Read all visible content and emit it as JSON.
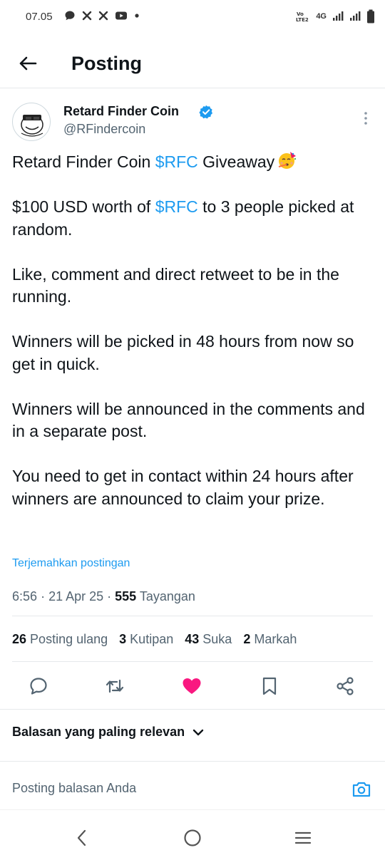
{
  "status_bar": {
    "time": "07.05",
    "network_label": "4G",
    "volte_label": "VoLTE2",
    "icons": [
      "chat-bubble-icon",
      "x-logo-icon",
      "x-logo-icon",
      "youtube-icon",
      "dot-icon",
      "volte-icon",
      "signal-icon",
      "signal-icon",
      "battery-icon"
    ]
  },
  "header": {
    "title": "Posting",
    "back_icon": "arrow-left-icon"
  },
  "post": {
    "author": {
      "name": "Retard Finder Coin",
      "handle": "@RFindercoin",
      "verified": true
    },
    "body": {
      "p1": {
        "before": "Retard Finder Coin ",
        "cashtag": "$RFC",
        "after": " Giveaway",
        "emoji": "party-face-icon"
      },
      "p2": {
        "before": "$100 USD worth of ",
        "cashtag": "$RFC",
        "after": " to 3 people picked at random."
      },
      "p3": "Like, comment and direct retweet to be in the running.",
      "p4": "Winners will be picked in 48 hours from now so get in quick.",
      "p5": "Winners will be announced in the comments and in a separate post.",
      "p6": "You need to get in contact within 24 hours after winners are announced to claim your prize."
    },
    "translate_label": "Terjemahkan postingan",
    "meta": {
      "time": "6:56",
      "date": "21 Apr 25",
      "views_count": "555",
      "views_label": "Tayangan"
    },
    "stats": {
      "reposts": {
        "count": "26",
        "label": "Posting ulang"
      },
      "quotes": {
        "count": "3",
        "label": "Kutipan"
      },
      "likes": {
        "count": "43",
        "label": "Suka"
      },
      "bookmarks": {
        "count": "2",
        "label": "Markah"
      }
    },
    "liked": true
  },
  "replies": {
    "sort_label": "Balasan yang paling relevan",
    "input_placeholder": "Posting balasan Anda"
  },
  "colors": {
    "accent": "#1d9bf0",
    "like": "#f91880",
    "text": "#0f1419",
    "secondary": "#536471",
    "divider": "#e6e9eb"
  }
}
